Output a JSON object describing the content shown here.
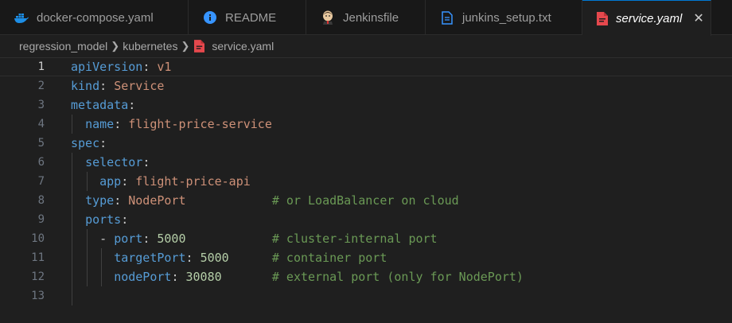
{
  "tabs": [
    {
      "label": "docker-compose.yaml",
      "icon": "docker-icon",
      "active": false
    },
    {
      "label": "README",
      "icon": "info-icon",
      "active": false
    },
    {
      "label": "Jenkinsfile",
      "icon": "jenkins-icon",
      "active": false
    },
    {
      "label": "junkins_setup.txt",
      "icon": "text-file-icon",
      "active": false
    },
    {
      "label": "service.yaml",
      "icon": "yaml-file-icon",
      "active": true
    }
  ],
  "breadcrumb": {
    "folder1": "regression_model",
    "folder2": "kubernetes",
    "file": "service.yaml"
  },
  "editor": {
    "active_line": 1,
    "lines": [
      {
        "num": "1",
        "tokens": [
          {
            "t": "apiVersion",
            "c": "k"
          },
          {
            "t": ": ",
            "c": "p"
          },
          {
            "t": "v1",
            "c": "s"
          }
        ]
      },
      {
        "num": "2",
        "tokens": [
          {
            "t": "kind",
            "c": "k"
          },
          {
            "t": ": ",
            "c": "p"
          },
          {
            "t": "Service",
            "c": "s"
          }
        ]
      },
      {
        "num": "3",
        "tokens": [
          {
            "t": "metadata",
            "c": "k"
          },
          {
            "t": ":",
            "c": "p"
          }
        ]
      },
      {
        "num": "4",
        "tokens": [
          {
            "t": "  ",
            "c": "p"
          },
          {
            "t": "name",
            "c": "k"
          },
          {
            "t": ": ",
            "c": "p"
          },
          {
            "t": "flight-price-service",
            "c": "s"
          }
        ]
      },
      {
        "num": "5",
        "tokens": [
          {
            "t": "spec",
            "c": "k"
          },
          {
            "t": ":",
            "c": "p"
          }
        ]
      },
      {
        "num": "6",
        "tokens": [
          {
            "t": "  ",
            "c": "p"
          },
          {
            "t": "selector",
            "c": "k"
          },
          {
            "t": ":",
            "c": "p"
          }
        ]
      },
      {
        "num": "7",
        "tokens": [
          {
            "t": "    ",
            "c": "p"
          },
          {
            "t": "app",
            "c": "k"
          },
          {
            "t": ": ",
            "c": "p"
          },
          {
            "t": "flight-price-api",
            "c": "s"
          }
        ]
      },
      {
        "num": "8",
        "tokens": [
          {
            "t": "  ",
            "c": "p"
          },
          {
            "t": "type",
            "c": "k"
          },
          {
            "t": ": ",
            "c": "p"
          },
          {
            "t": "NodePort",
            "c": "s"
          },
          {
            "t": "            ",
            "c": "p"
          },
          {
            "t": "# or LoadBalancer on cloud",
            "c": "c"
          }
        ]
      },
      {
        "num": "9",
        "tokens": [
          {
            "t": "  ",
            "c": "p"
          },
          {
            "t": "ports",
            "c": "k"
          },
          {
            "t": ":",
            "c": "p"
          }
        ]
      },
      {
        "num": "10",
        "tokens": [
          {
            "t": "    ",
            "c": "p"
          },
          {
            "t": "- ",
            "c": "p"
          },
          {
            "t": "port",
            "c": "k"
          },
          {
            "t": ": ",
            "c": "p"
          },
          {
            "t": "5000",
            "c": "n"
          },
          {
            "t": "            ",
            "c": "p"
          },
          {
            "t": "# cluster-internal port",
            "c": "c"
          }
        ]
      },
      {
        "num": "11",
        "tokens": [
          {
            "t": "      ",
            "c": "p"
          },
          {
            "t": "targetPort",
            "c": "k"
          },
          {
            "t": ": ",
            "c": "p"
          },
          {
            "t": "5000",
            "c": "n"
          },
          {
            "t": "      ",
            "c": "p"
          },
          {
            "t": "# container port",
            "c": "c"
          }
        ]
      },
      {
        "num": "12",
        "tokens": [
          {
            "t": "      ",
            "c": "p"
          },
          {
            "t": "nodePort",
            "c": "k"
          },
          {
            "t": ": ",
            "c": "p"
          },
          {
            "t": "30080",
            "c": "n"
          },
          {
            "t": "       ",
            "c": "p"
          },
          {
            "t": "# external port (only for NodePort)",
            "c": "c"
          }
        ]
      },
      {
        "num": "13",
        "tokens": []
      }
    ]
  }
}
